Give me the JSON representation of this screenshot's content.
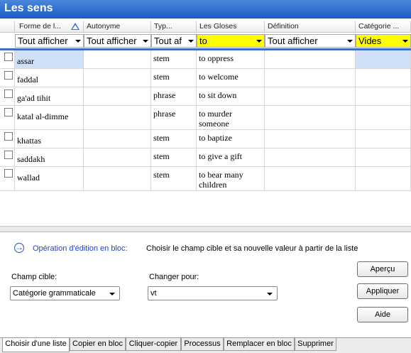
{
  "window": {
    "title": "Les sens"
  },
  "columns": [
    {
      "label": "Forme de l..."
    },
    {
      "label": "Autonyme"
    },
    {
      "label": "Typ..."
    },
    {
      "label": "Les Gloses"
    },
    {
      "label": "Définition"
    },
    {
      "label": "Catégorie ..."
    }
  ],
  "filters": [
    "Tout afficher",
    "Tout afficher",
    "Tout af",
    "to",
    "Tout afficher",
    "Vides"
  ],
  "rows": [
    {
      "form": "assar",
      "autonym": "",
      "type": "stem",
      "gloss": "to oppress",
      "definition": "",
      "category": ""
    },
    {
      "form": "faddal",
      "autonym": "",
      "type": "stem",
      "gloss": "to welcome",
      "definition": "",
      "category": ""
    },
    {
      "form": "ga'ad tihit",
      "autonym": "",
      "type": "phrase",
      "gloss": "to sit down",
      "definition": "",
      "category": ""
    },
    {
      "form": "katal al-dimme",
      "autonym": "",
      "type": "phrase",
      "gloss": "to murder someone",
      "definition": "",
      "category": ""
    },
    {
      "form": "khattas",
      "autonym": "",
      "type": "stem",
      "gloss": "to baptize",
      "definition": "",
      "category": ""
    },
    {
      "form": "saddakh",
      "autonym": "",
      "type": "stem",
      "gloss": "to give a gift",
      "definition": "",
      "category": ""
    },
    {
      "form": "wallad",
      "autonym": "",
      "type": "stem",
      "gloss": "to bear many children",
      "definition": "",
      "category": ""
    }
  ],
  "bulk": {
    "link": "Opération d'édition en bloc:",
    "hint": "Choisir le champ cible et sa nouvelle valeur à partir de la liste",
    "target_label": "Champ cible:",
    "target_value": "Catégorie grammaticale",
    "change_label": "Changer pour:",
    "change_value": "vt",
    "preview": "Aperçu",
    "apply": "Appliquer",
    "help": "Aide"
  },
  "tabs": [
    "Choisir d'une liste",
    "Copier en bloc",
    "Cliquer-copier",
    "Processus",
    "Remplacer en bloc",
    "Supprimer"
  ],
  "colors": {
    "title_bar": "#2563cf",
    "filter_highlight": "#ffff00",
    "selection": "#cfe0f8",
    "link": "#1f3fd1"
  }
}
